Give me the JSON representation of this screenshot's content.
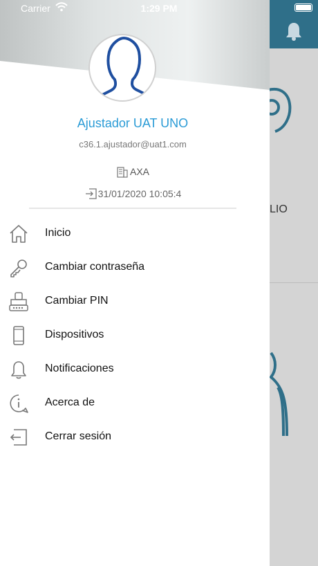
{
  "status_bar": {
    "carrier": "Carrier",
    "time": "1:29 PM"
  },
  "background": {
    "partial_text": "LIO"
  },
  "profile": {
    "name": "Ajustador UAT UNO",
    "email": "c36.1.ajustador@uat1.com",
    "company": "AXA",
    "last_login": "31/01/2020 10:05:4"
  },
  "menu": {
    "items": [
      {
        "label": "Inicio",
        "icon": "home-icon"
      },
      {
        "label": "Cambiar contraseña",
        "icon": "key-icon"
      },
      {
        "label": "Cambiar PIN",
        "icon": "pin-icon"
      },
      {
        "label": "Dispositivos",
        "icon": "phone-icon"
      },
      {
        "label": "Notificaciones",
        "icon": "bell-icon"
      },
      {
        "label": "Acerca de",
        "icon": "info-icon"
      },
      {
        "label": "Cerrar sesión",
        "icon": "logout-icon"
      }
    ]
  },
  "colors": {
    "accent": "#2a9bd6",
    "header": "#2f6f89",
    "avatar_outline": "#1f4fa0"
  }
}
